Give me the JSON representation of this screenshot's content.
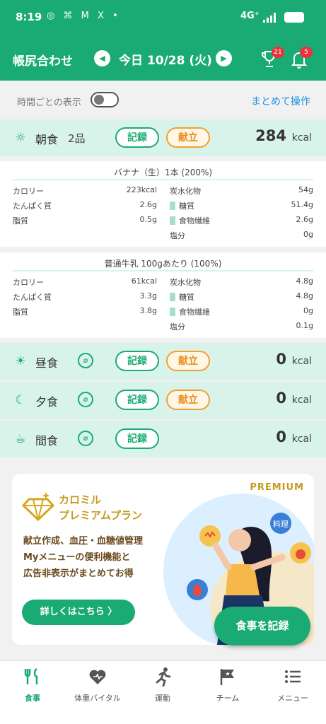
{
  "status_bar": {
    "time": "8:19",
    "network": "4G⁺"
  },
  "header": {
    "title": "帳尻合わせ",
    "date": "今日 10/28 (火)",
    "trophy_badge": "21",
    "bell_badge": "5"
  },
  "toggle_row": {
    "label": "時間ごとの表示",
    "bulk_action": "まとめて操作"
  },
  "breakfast": {
    "name": "朝食",
    "count": "2品",
    "record_label": "記録",
    "menu_label": "献立",
    "kcal": "284",
    "unit": "kcal"
  },
  "foods": [
    {
      "name": "バナナ（生）1本 (200%)",
      "rows": [
        {
          "l": "カロリー",
          "v": "223kcal",
          "l2": "炭水化物",
          "v2": "54g",
          "sub": false
        },
        {
          "l": "たんぱく質",
          "v": "2.6g",
          "l2": "糖質",
          "v2": "51.4g",
          "sub": true
        },
        {
          "l": "脂質",
          "v": "0.5g",
          "l2": "食物繊維",
          "v2": "2.6g",
          "sub": true
        },
        {
          "l": "",
          "v": "",
          "l2": "塩分",
          "v2": "0g",
          "sub": false
        }
      ]
    },
    {
      "name": "普通牛乳 100gあたり (100%)",
      "rows": [
        {
          "l": "カロリー",
          "v": "61kcal",
          "l2": "炭水化物",
          "v2": "4.8g",
          "sub": false
        },
        {
          "l": "たんぱく質",
          "v": "3.3g",
          "l2": "糖質",
          "v2": "4.8g",
          "sub": true
        },
        {
          "l": "脂質",
          "v": "3.8g",
          "l2": "食物繊維",
          "v2": "0g",
          "sub": true
        },
        {
          "l": "",
          "v": "",
          "l2": "塩分",
          "v2": "0.1g",
          "sub": false
        }
      ]
    }
  ],
  "lunch": {
    "name": "昼食",
    "record_label": "記録",
    "menu_label": "献立",
    "kcal": "0",
    "unit": "kcal"
  },
  "dinner": {
    "name": "夕食",
    "record_label": "記録",
    "menu_label": "献立",
    "kcal": "0",
    "unit": "kcal"
  },
  "snack": {
    "name": "間食",
    "record_label": "記録",
    "kcal": "0",
    "unit": "kcal"
  },
  "promo": {
    "badge": "PREMIUM",
    "title_line1": "カロミル",
    "title_line2": "プレミアムプラン",
    "desc_line1": "献立作成、血圧・血糖値管理",
    "desc_line2": "Myメニューの便利機能と",
    "desc_line3": "広告非表示がまとめてお得",
    "button": "詳しくはこちら  〉",
    "bubble_text": "料理"
  },
  "fab": "食事を記録",
  "nav": [
    {
      "label": "食事",
      "icon": "fork-knife-icon"
    },
    {
      "label": "体重バイタル",
      "icon": "heart-scale-icon"
    },
    {
      "label": "運動",
      "icon": "runner-icon"
    },
    {
      "label": "チーム",
      "icon": "flag-icon"
    },
    {
      "label": "メニュー",
      "icon": "menu-list-icon"
    }
  ],
  "colors": {
    "primary": "#1aab74",
    "meal_bg": "#d8f3ea",
    "menu_orange": "#f0a033",
    "badge_red": "#e8343a",
    "link_blue": "#1a8fe0",
    "premium_gold": "#c49a1f"
  }
}
